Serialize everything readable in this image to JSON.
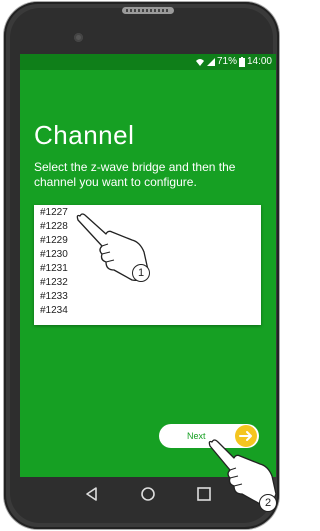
{
  "status": {
    "battery": "71%",
    "time": "14:00"
  },
  "screen": {
    "title": "Channel",
    "description": "Select the z-wave bridge and then the channel you want to configure."
  },
  "channels": [
    "#1227",
    "#1228",
    "#1229",
    "#1230",
    "#1231",
    "#1232",
    "#1233",
    "#1234"
  ],
  "next_label": "Next",
  "annotations": {
    "step1": "1",
    "step2": "2"
  },
  "colors": {
    "screen_bg": "#16a023",
    "accent": "#f4c51f"
  }
}
